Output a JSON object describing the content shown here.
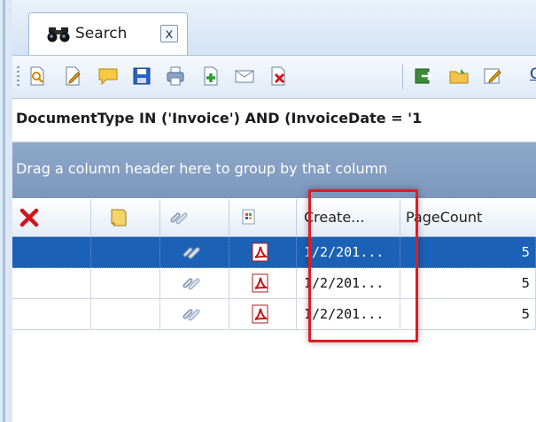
{
  "tab": {
    "label": "Search",
    "close_glyph": "x"
  },
  "toolbar": {
    "buttons": [
      "view-document-icon",
      "edit-document-icon",
      "note-icon",
      "save-icon",
      "print-icon",
      "add-page-icon",
      "email-icon",
      "delete-document-icon",
      "export-icon",
      "open-folder-icon",
      "edit-index-icon"
    ],
    "overflow_text": "G"
  },
  "query": {
    "text": "DocumentType IN ('Invoice') AND (InvoiceDate = '1"
  },
  "group_bar": {
    "text": "Drag a column header here to group by that column"
  },
  "grid": {
    "columns": [
      {
        "name": "delete",
        "icon": "red-x-icon",
        "label": ""
      },
      {
        "name": "note",
        "icon": "note-icon",
        "label": ""
      },
      {
        "name": "link",
        "icon": "link-icon",
        "label": ""
      },
      {
        "name": "filetype",
        "icon": "file-type-icon",
        "label": ""
      },
      {
        "name": "created",
        "icon": "",
        "label": "Create..."
      },
      {
        "name": "pagecount",
        "icon": "",
        "label": "PageCount"
      }
    ],
    "rows": [
      {
        "selected": true,
        "created": "1/2/201...",
        "pagecount": "5",
        "filetype": "pdf-icon",
        "link": "link-icon"
      },
      {
        "selected": false,
        "created": "1/2/201...",
        "pagecount": "5",
        "filetype": "pdf-icon",
        "link": "link-icon"
      },
      {
        "selected": false,
        "created": "1/2/201...",
        "pagecount": "5",
        "filetype": "pdf-icon",
        "link": "link-icon"
      }
    ]
  },
  "highlight_color": "#e11a22",
  "selection_color": "#1b61b5"
}
